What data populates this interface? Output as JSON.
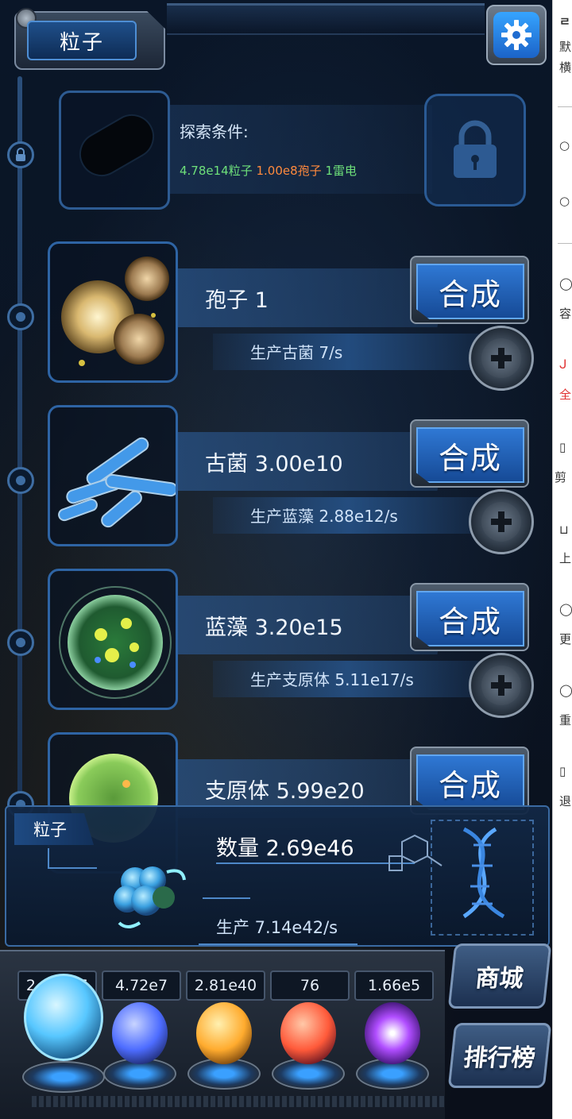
{
  "header": {
    "title": "粒子"
  },
  "locked": {
    "condition_label": "探索条件:",
    "requirements": [
      {
        "text": "4.78e14粒子",
        "color": "#6ee07a"
      },
      {
        "text": "1.00e8孢子",
        "color": "#ff8a3d"
      },
      {
        "text": "1雷电",
        "color": "#6ee07a"
      }
    ]
  },
  "creatures": [
    {
      "name": "孢子 1",
      "production": "生产古菌 7/s",
      "button": "合成"
    },
    {
      "name": "古菌 3.00e10",
      "production": "生产蓝藻 2.88e12/s",
      "button": "合成"
    },
    {
      "name": "蓝藻 3.20e15",
      "production": "生产支原体 5.11e17/s",
      "button": "合成"
    },
    {
      "name": "支原体 5.99e20",
      "production": "",
      "button": "合成"
    }
  ],
  "info": {
    "tag": "粒子",
    "count": "数量 2.69e46",
    "production": "生产 7.14e42/s"
  },
  "resources": [
    {
      "value": "2.69e46",
      "orb_color": "#57c7ff"
    },
    {
      "value": "4.72e7",
      "orb_color": "#4d6cff"
    },
    {
      "value": "2.81e40",
      "orb_color": "#ffab2e"
    },
    {
      "value": "76",
      "orb_color": "#ff5a3a"
    },
    {
      "value": "1.66e5",
      "orb_color": "#b04dff"
    }
  ],
  "buttons": {
    "shop": "商城",
    "rank": "排行榜"
  },
  "side_panel": {
    "glyphs": [
      "默",
      "横",
      "容",
      "全",
      "剪",
      "上",
      "更",
      "重",
      "退"
    ]
  }
}
